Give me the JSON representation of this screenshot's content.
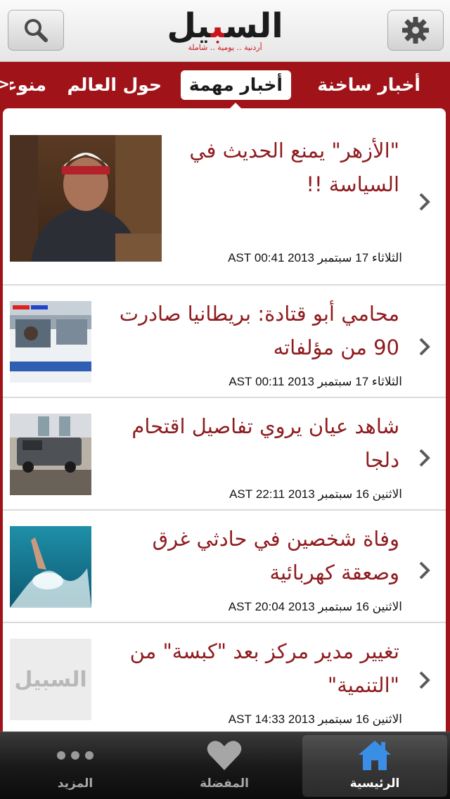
{
  "header": {
    "logo_main_prefix": "الس",
    "logo_main_accent": "ب",
    "logo_main_suffix": "يل",
    "logo_tagline": "أردنية .. يومية .. شاملة",
    "icons": {
      "search": "search-icon",
      "settings": "gear-icon"
    }
  },
  "tabs": [
    {
      "label": "أخبار ساخنة",
      "selected": false
    },
    {
      "label": "أخبار مهمة",
      "selected": true
    },
    {
      "label": "حول العالم",
      "selected": false
    },
    {
      "label": "منوعات",
      "selected": false
    }
  ],
  "more_tabs_indicator": "<",
  "news": [
    {
      "headline": "\"الأزهر\" يمنع الحديث في السياسة !!",
      "date": "الثلاثاء 17 سبتمبر 2013 00:41 AST",
      "thumbnail": "person-photo"
    },
    {
      "headline": "محامي أبو قتادة: بريطانيا صادرت 90 من مؤلفاته",
      "date": "الثلاثاء 17 سبتمبر 2013 00:11 AST",
      "thumbnail": "police-car-photo"
    },
    {
      "headline": "شاهد عيان يروي تفاصيل اقتحام دلجا",
      "date": "الاثنين 16 سبتمبر 2013 22:11 AST",
      "thumbnail": "armored-vehicle-photo"
    },
    {
      "headline": "وفاة شخصين في حادثي غرق وصعقة كهربائية",
      "date": "الاثنين 16 سبتمبر 2013 20:04 AST",
      "thumbnail": "drowning-photo"
    },
    {
      "headline": "تغيير مدير مركز بعد \"كبسة\" من \"التنمية\"",
      "date": "الاثنين 16 سبتمبر 2013 14:33 AST",
      "thumbnail": "logo-placeholder",
      "thumbnail_text": "السبيل"
    }
  ],
  "bottom_tabs": [
    {
      "label": "المزيد",
      "icon": "more-dots-icon",
      "active": false
    },
    {
      "label": "المفضلة",
      "icon": "heart-icon",
      "active": false
    },
    {
      "label": "الرئيسية",
      "icon": "home-icon",
      "active": true
    }
  ],
  "colors": {
    "brand_red": "#a01419",
    "headline": "#8f1b1e",
    "active_tab_icon": "#3a8ee6"
  }
}
